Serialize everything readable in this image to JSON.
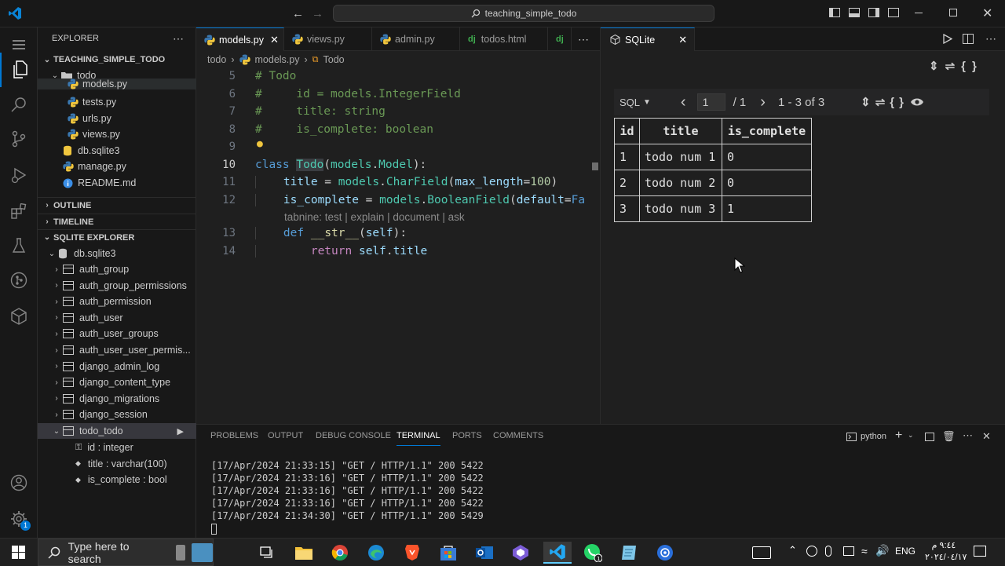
{
  "titlebar": {
    "search_text": "teaching_simple_todo"
  },
  "sidebar": {
    "explorer_title": "EXPLORER",
    "project_name": "TEACHING_SIMPLE_TODO",
    "folder": "todo",
    "files": [
      {
        "name": "models.py",
        "type": "python"
      },
      {
        "name": "tests.py",
        "type": "python"
      },
      {
        "name": "urls.py",
        "type": "python"
      },
      {
        "name": "views.py",
        "type": "python"
      }
    ],
    "root_files": [
      {
        "name": "db.sqlite3",
        "type": "database"
      },
      {
        "name": "manage.py",
        "type": "python"
      },
      {
        "name": "README.md",
        "type": "info"
      }
    ],
    "outline": "OUTLINE",
    "timeline": "TIMELINE",
    "sqlite_explorer": "SQLITE EXPLORER",
    "database": "db.sqlite3",
    "tables": [
      "auth_group",
      "auth_group_permissions",
      "auth_permission",
      "auth_user",
      "auth_user_groups",
      "auth_user_user_permis...",
      "django_admin_log",
      "django_content_type",
      "django_migrations",
      "django_session",
      "todo_todo"
    ],
    "columns": [
      "id : integer",
      "title : varchar(100)",
      "is_complete : bool"
    ]
  },
  "editor": {
    "tabs": [
      "models.py",
      "views.py",
      "admin.py",
      "todos.html"
    ],
    "breadcrumb": [
      "todo",
      "models.py",
      "Todo"
    ],
    "codelens": "tabnine: test | explain | document | ask",
    "line_numbers": [
      "5",
      "6",
      "7",
      "8",
      "9",
      "10",
      "11",
      "12",
      "13",
      "14"
    ]
  },
  "sqlite": {
    "tab_label": "SQLite",
    "mode": "SQL",
    "page_input": "1",
    "page_total": "/ 1",
    "range": "1 - 3 of 3",
    "columns": [
      "id",
      "title",
      "is_complete"
    ],
    "rows": [
      [
        "1",
        "todo num 1",
        "0"
      ],
      [
        "2",
        "todo num 2",
        "0"
      ],
      [
        "3",
        "todo num 3",
        "1"
      ]
    ]
  },
  "panel": {
    "tabs": [
      "PROBLEMS",
      "OUTPUT",
      "DEBUG CONSOLE",
      "TERMINAL",
      "PORTS",
      "COMMENTS"
    ],
    "active_tab": "TERMINAL",
    "shell": "python",
    "lines": [
      "[17/Apr/2024 21:33:15] \"GET / HTTP/1.1\" 200 5422",
      "[17/Apr/2024 21:33:16] \"GET / HTTP/1.1\" 200 5422",
      "[17/Apr/2024 21:33:16] \"GET / HTTP/1.1\" 200 5422",
      "[17/Apr/2024 21:33:16] \"GET / HTTP/1.1\" 200 5422",
      "[17/Apr/2024 21:34:30] \"GET / HTTP/1.1\" 200 5429"
    ]
  },
  "taskbar": {
    "search_placeholder": "Type here to search",
    "lang": "ENG",
    "time": "٩:٤٤ م",
    "date": "٢٠٢٤/٠٤/١٧"
  },
  "colors": {
    "accent": "#0078d4",
    "bg": "#1f1f1f",
    "sidebar_bg": "#181818"
  }
}
